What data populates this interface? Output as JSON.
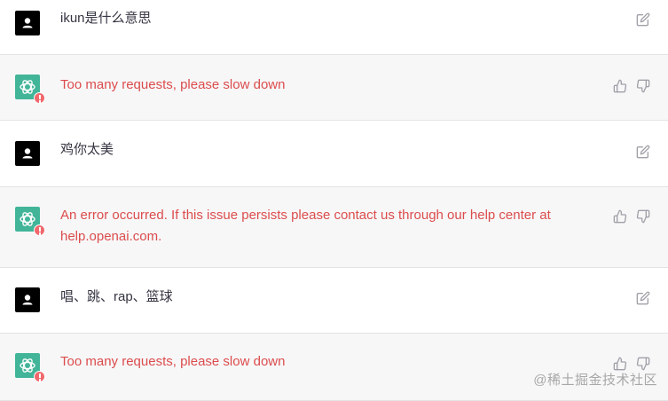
{
  "messages": [
    {
      "role": "user",
      "text": "ikun是什么意思"
    },
    {
      "role": "assistant",
      "text": "Too many requests, please slow down"
    },
    {
      "role": "user",
      "text": "鸡你太美"
    },
    {
      "role": "assistant",
      "text": "An error occurred. If this issue persists please contact us through our help center at help.openai.com."
    },
    {
      "role": "user",
      "text": "唱、跳、rap、篮球"
    },
    {
      "role": "assistant",
      "text": "Too many requests, please slow down"
    }
  ],
  "icons": {
    "user_avatar": "user-icon",
    "bot_avatar": "openai-logo-icon",
    "error": "error-badge-icon",
    "edit": "edit-icon",
    "like": "thumbs-up-icon",
    "dislike": "thumbs-down-icon"
  },
  "colors": {
    "error_text": "#dc4c4c",
    "bot_bg": "#f7f7f8",
    "bot_avatar": "#10a37f",
    "error_badge": "#ef4146"
  },
  "watermark": "@稀土掘金技术社区"
}
